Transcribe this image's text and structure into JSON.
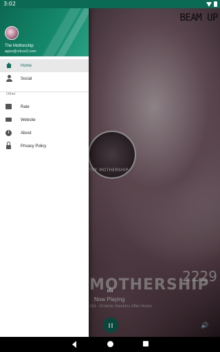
{
  "status_bar": {
    "time": "3:02"
  },
  "background": {
    "banner_text": "BEAM UP",
    "circle_caption": "THE MOTHERSHIP",
    "number_text": "2229",
    "logo_text": "MOTHERSHIP"
  },
  "player": {
    "now_playing_label": "Now Playing",
    "track_text": "rtist - Erskine Hawkins After Hours",
    "play_state": "pause",
    "accent_color": "#0d6e5c"
  },
  "drawer": {
    "header": {
      "name": "The Mothership",
      "email": "apps@citrus3.com"
    },
    "items": [
      {
        "label": "Home",
        "icon": "home-icon",
        "active": true
      },
      {
        "label": "Social",
        "icon": "person-icon",
        "active": false
      }
    ],
    "section_label": "Other",
    "other_items": [
      {
        "label": "Rate",
        "icon": "rate-icon"
      },
      {
        "label": "Website",
        "icon": "website-icon"
      },
      {
        "label": "About",
        "icon": "info-icon"
      },
      {
        "label": "Privacy Policy",
        "icon": "lock-icon"
      }
    ]
  },
  "colors": {
    "primary": "#0c6a54",
    "accent": "#0d6e5c"
  }
}
